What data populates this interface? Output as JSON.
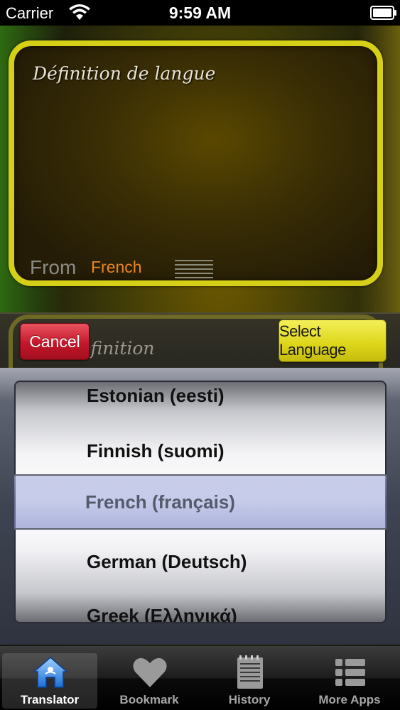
{
  "status_bar": {
    "carrier": "Carrier",
    "time": "9:59 AM"
  },
  "translator_panel": {
    "title": "Définition de langue",
    "from_label": "From",
    "from_language": "French"
  },
  "second_panel": {
    "title_fragment": "ge definition"
  },
  "buttons": {
    "cancel_label": "Cancel",
    "select_language_label": "Select Language"
  },
  "picker": {
    "items": [
      "Estonian (eesti)",
      "Finnish (suomi)",
      "French (français)",
      "German (Deutsch)",
      "Greek (Ελληνικά)"
    ],
    "selected": "French (français)"
  },
  "tab_bar": {
    "tabs": [
      {
        "label": "Translator",
        "icon": "house-icon",
        "active": true
      },
      {
        "label": "Bookmark",
        "icon": "heart-icon",
        "active": false
      },
      {
        "label": "History",
        "icon": "notepad-icon",
        "active": false
      },
      {
        "label": "More Apps",
        "icon": "list-icon",
        "active": false
      }
    ]
  },
  "colors": {
    "card_border": "#d6cf17",
    "from_value": "#e9851f",
    "cancel_button": "#c4182b",
    "select_button": "#dcd518"
  }
}
